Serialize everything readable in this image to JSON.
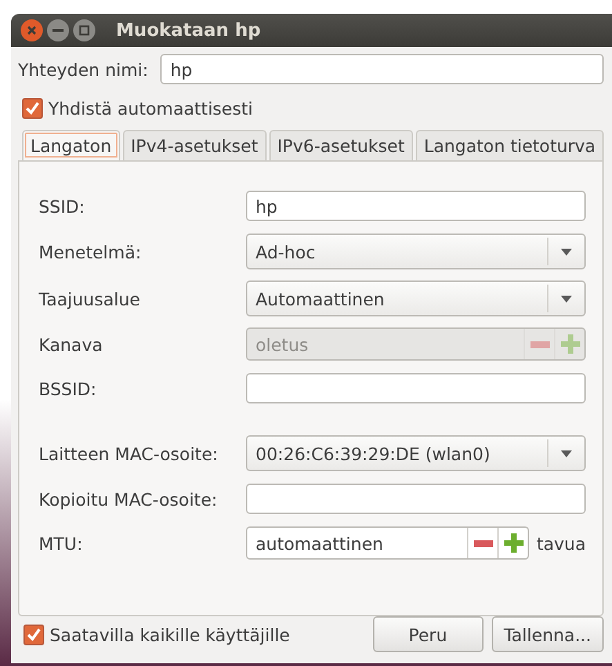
{
  "window": {
    "title": "Muokataan hp"
  },
  "connection_name": {
    "label": "Yhteyden nimi:",
    "value": "hp"
  },
  "auto_connect": {
    "label": "Yhdistä automaattisesti",
    "checked": true
  },
  "tabs": [
    {
      "label": "Langaton",
      "selected": true
    },
    {
      "label": "IPv4-asetukset",
      "selected": false
    },
    {
      "label": "IPv6-asetukset",
      "selected": false
    },
    {
      "label": "Langaton tietoturva",
      "selected": false
    }
  ],
  "sections": [
    {
      "fields": [
        {
          "kind": "text",
          "label": "SSID:",
          "value": "hp"
        },
        {
          "kind": "combo",
          "label": "Menetelmä:",
          "value": "Ad-hoc"
        },
        {
          "kind": "combo",
          "label": "Taajuusalue",
          "value": "Automaattinen"
        },
        {
          "kind": "spin",
          "label": "Kanava",
          "value": "oletus",
          "disabled": true
        },
        {
          "kind": "text",
          "label": "BSSID:"
        }
      ]
    },
    {
      "fields": [
        {
          "kind": "combo",
          "label": "Laitteen MAC-osoite:",
          "value": "00:26:C6:39:29:DE (wlan0)"
        },
        {
          "kind": "text",
          "label": "Kopioitu MAC-osoite:"
        },
        {
          "kind": "spin",
          "label": "MTU:",
          "value": "automaattinen",
          "disabled": false,
          "unit": "tavua"
        }
      ]
    }
  ],
  "all_users": {
    "label": "Saatavilla kaikille käyttäjille",
    "checked": true
  },
  "buttons": [
    {
      "label": "Peru"
    },
    {
      "label": "Tallenna..."
    }
  ]
}
